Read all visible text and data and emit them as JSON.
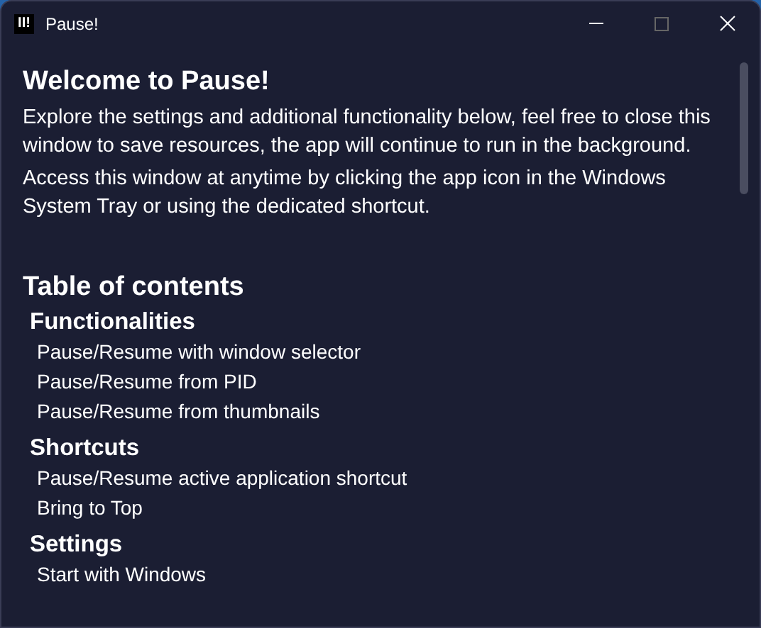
{
  "window": {
    "title": "Pause!",
    "app_icon": "II!"
  },
  "welcome": {
    "heading": "Welcome to Pause!",
    "paragraphs": [
      "Explore the settings and additional functionality below, feel free to close this window to save resources, the app will continue to run in the background.",
      "Access this window at anytime by clicking the app icon in the Windows System Tray or using the dedicated shortcut."
    ]
  },
  "toc": {
    "heading": "Table of contents",
    "sections": [
      {
        "title": "Functionalities",
        "items": [
          "Pause/Resume with window selector",
          "Pause/Resume from PID",
          "Pause/Resume from thumbnails"
        ]
      },
      {
        "title": "Shortcuts",
        "items": [
          "Pause/Resume active application shortcut",
          "Bring to Top"
        ]
      },
      {
        "title": "Settings",
        "items": [
          "Start with Windows"
        ]
      }
    ]
  }
}
